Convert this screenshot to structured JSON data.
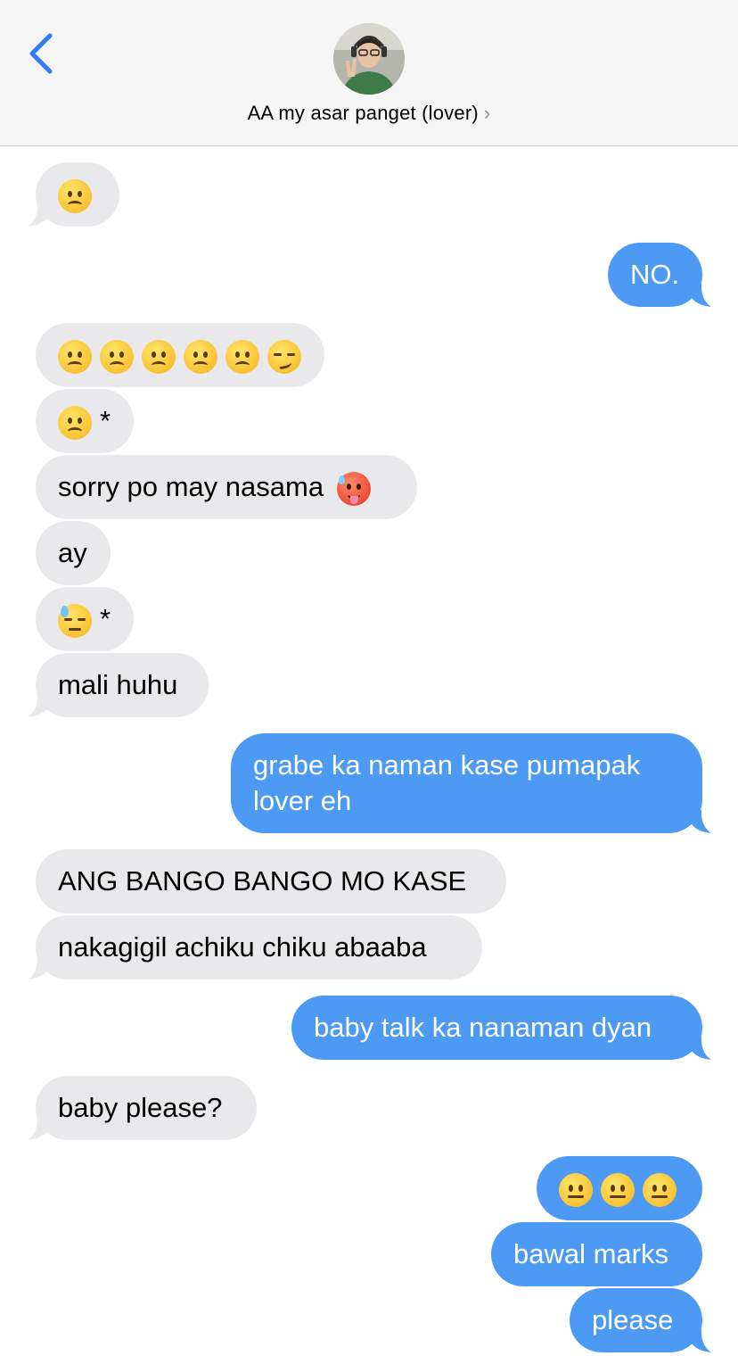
{
  "header": {
    "contact_name": "AA my asar panget (lover)",
    "chevron": "›",
    "back_icon": "chevron-left-icon",
    "accent_color": "#3478f6"
  },
  "colors": {
    "incoming": "#e9e9eb",
    "outgoing": "#4c9af4"
  },
  "messages": [
    {
      "dir": "in",
      "emoji": [
        "frowning-face"
      ]
    },
    {
      "dir": "out",
      "text": "NO."
    },
    {
      "dir": "in",
      "emoji": [
        "frowning-face",
        "frowning-face",
        "frowning-face",
        "frowning-face",
        "frowning-face",
        "smirking-face"
      ]
    },
    {
      "dir": "in",
      "emoji": [
        "frowning-face"
      ],
      "suffix": "*"
    },
    {
      "dir": "in",
      "text": "sorry po may nasama",
      "emoji": [
        "hot-face"
      ]
    },
    {
      "dir": "in",
      "text": "ay"
    },
    {
      "dir": "in",
      "emoji": [
        "downcast-sweat-face"
      ],
      "suffix": "*"
    },
    {
      "dir": "in",
      "text": "mali huhu"
    },
    {
      "dir": "out",
      "text": "grabe ka naman kase pumapak lover eh"
    },
    {
      "dir": "in",
      "text": "ANG BANGO BANGO MO KASE"
    },
    {
      "dir": "in",
      "text": "nakagigil achiku chiku abaaba"
    },
    {
      "dir": "out",
      "text": "baby talk ka nanaman dyan"
    },
    {
      "dir": "in",
      "text": "baby please?"
    },
    {
      "dir": "out",
      "emoji": [
        "neutral-face",
        "neutral-face",
        "neutral-face"
      ]
    },
    {
      "dir": "out",
      "text": "bawal marks"
    },
    {
      "dir": "out",
      "text": "please"
    }
  ]
}
